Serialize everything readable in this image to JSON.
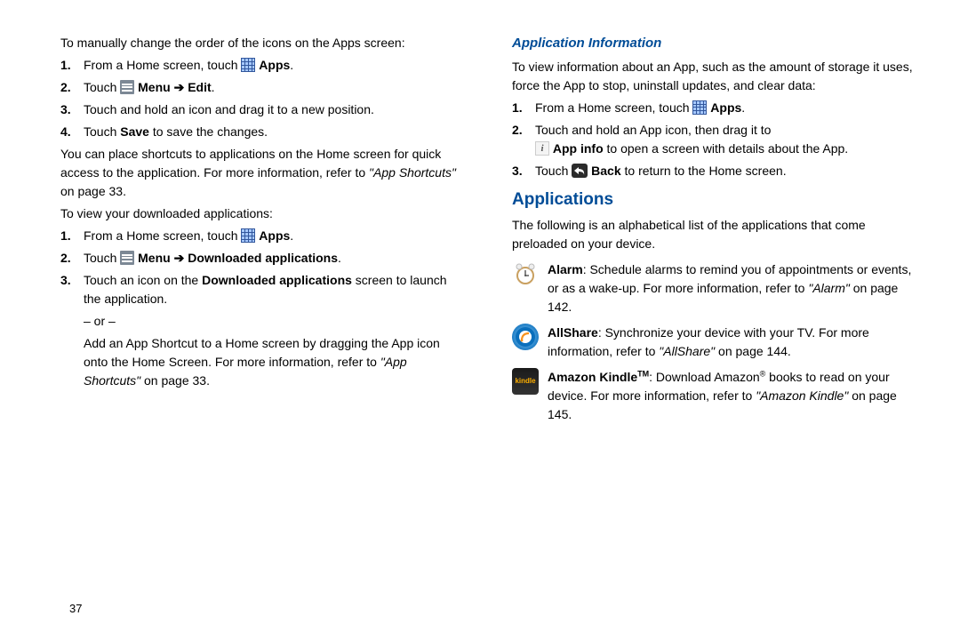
{
  "page_number": "37",
  "left": {
    "intro": "To manually change the order of the icons on the Apps screen:",
    "list1": {
      "i1_pre": "From a Home screen, touch ",
      "i1_post": " Apps",
      "i1_dot": ".",
      "i2_pre": "Touch ",
      "i2_menu": " Menu ",
      "i2_arrow": "➔",
      "i2_post": " Edit",
      "i2_dot": ".",
      "i3": "Touch and hold an icon and drag it to a new position.",
      "i4_pre": "Touch ",
      "i4_bold": "Save",
      "i4_post": " to save the changes."
    },
    "para2_a": "You can place shortcuts to applications on the Home screen for quick access to the application. For more information, refer to ",
    "para2_ref": "\"App Shortcuts\"",
    "para2_b": " on page 33.",
    "para3": "To view your downloaded applications:",
    "list2": {
      "i1_pre": "From a Home screen, touch ",
      "i1_post": " Apps",
      "i1_dot": ".",
      "i2_pre": "Touch ",
      "i2_menu": " Menu ",
      "i2_arrow": "➔",
      "i2_post": " Downloaded applications",
      "i2_dot": ".",
      "i3_a": "Touch an icon on the ",
      "i3_bold": "Downloaded applications",
      "i3_b": " screen to launch the application.",
      "or": "– or –",
      "i3_c": "Add an App Shortcut to a Home screen by dragging the App icon onto the Home Screen. For more information, refer to ",
      "i3_ref": "\"App Shortcuts\"",
      "i3_d": " on page 33."
    }
  },
  "right": {
    "h3": "Application Information",
    "intro": "To view information about an App, such as the amount of storage it uses, force the App to stop, uninstall updates, and clear data:",
    "list1": {
      "i1_pre": "From a Home screen, touch ",
      "i1_post": " Apps",
      "i1_dot": ".",
      "i2_a": "Touch and hold an App icon, then drag it to",
      "i2_bold": " App info",
      "i2_b": " to open a screen with details about the App.",
      "i3_pre": "Touch ",
      "i3_bold": " Back",
      "i3_post": " to return to the Home screen."
    },
    "h2": "Applications",
    "para": "The following is an alphabetical list of the applications that come preloaded on your device.",
    "apps": {
      "alarm_name": "Alarm",
      "alarm_text_a": ": Schedule alarms to remind you of appointments or events, or as a wake-up. For more information, refer to ",
      "alarm_ref": "\"Alarm\"",
      "alarm_text_b": " on page 142.",
      "allshare_name": "AllShare",
      "allshare_text_a": ": Synchronize your device with your TV. For more information, refer to ",
      "allshare_ref": "\"AllShare\"",
      "allshare_text_b": " on page 144.",
      "kindle_name": "Amazon Kindle",
      "kindle_tm": "TM",
      "kindle_text_a": ": Download Amazon",
      "kindle_reg": "®",
      "kindle_text_b": " books to read on your device. For more information, refer to ",
      "kindle_ref": "\"Amazon Kindle\"",
      "kindle_text_c": " on page 145."
    }
  }
}
